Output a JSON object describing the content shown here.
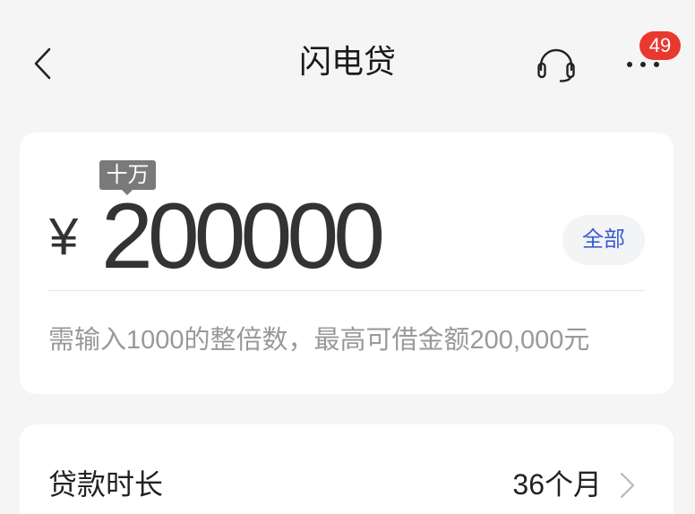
{
  "header": {
    "title": "闪电贷",
    "badge_count": "49",
    "icons": {
      "back": "chevron-left-icon",
      "service": "headset-icon",
      "more": "more-icon"
    }
  },
  "amount_card": {
    "unit_hint": "十万",
    "currency": "¥",
    "amount": "200000",
    "all_button": "全部",
    "hint": "需输入1000的整倍数，最高可借金额200,000元"
  },
  "term_card": {
    "label": "贷款时长",
    "value": "36个月",
    "icon": "chevron-right-icon"
  },
  "colors": {
    "background": "#f5f5f5",
    "card": "#ffffff",
    "text": "#222222",
    "muted": "#999999",
    "accent": "#3b5bd1",
    "badge": "#e8392f",
    "tooltip": "#7a7a7a"
  }
}
